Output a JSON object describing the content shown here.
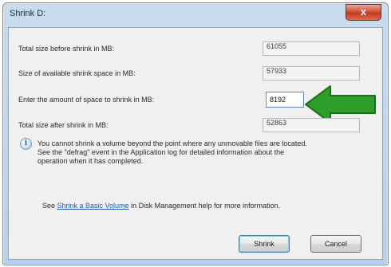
{
  "window": {
    "title": "Shrink D:",
    "close_glyph": "x"
  },
  "fields": {
    "total_before_label": "Total size before shrink in MB:",
    "total_before_value": "61055",
    "available_label": "Size of available shrink space in MB:",
    "available_value": "57933",
    "amount_label": "Enter the amount of space to shrink in MB:",
    "amount_value": "8192",
    "total_after_label": "Total size after shrink in MB:",
    "total_after_value": "52863"
  },
  "info": {
    "icon": "info-icon",
    "line1": "You cannot shrink a volume beyond the point where any unmovable files are located.",
    "line2": "See the \"defrag\" event in the Application log for detailed information about the",
    "line3": "operation when it has completed."
  },
  "help": {
    "prefix": "See ",
    "link_text": "Shrink a Basic Volume",
    "suffix": " in Disk Management help for more information."
  },
  "buttons": {
    "shrink": "Shrink",
    "cancel": "Cancel"
  },
  "annotation": {
    "arrow_icon": "arrow-left-icon",
    "arrow_color": "#2e9e2a"
  }
}
